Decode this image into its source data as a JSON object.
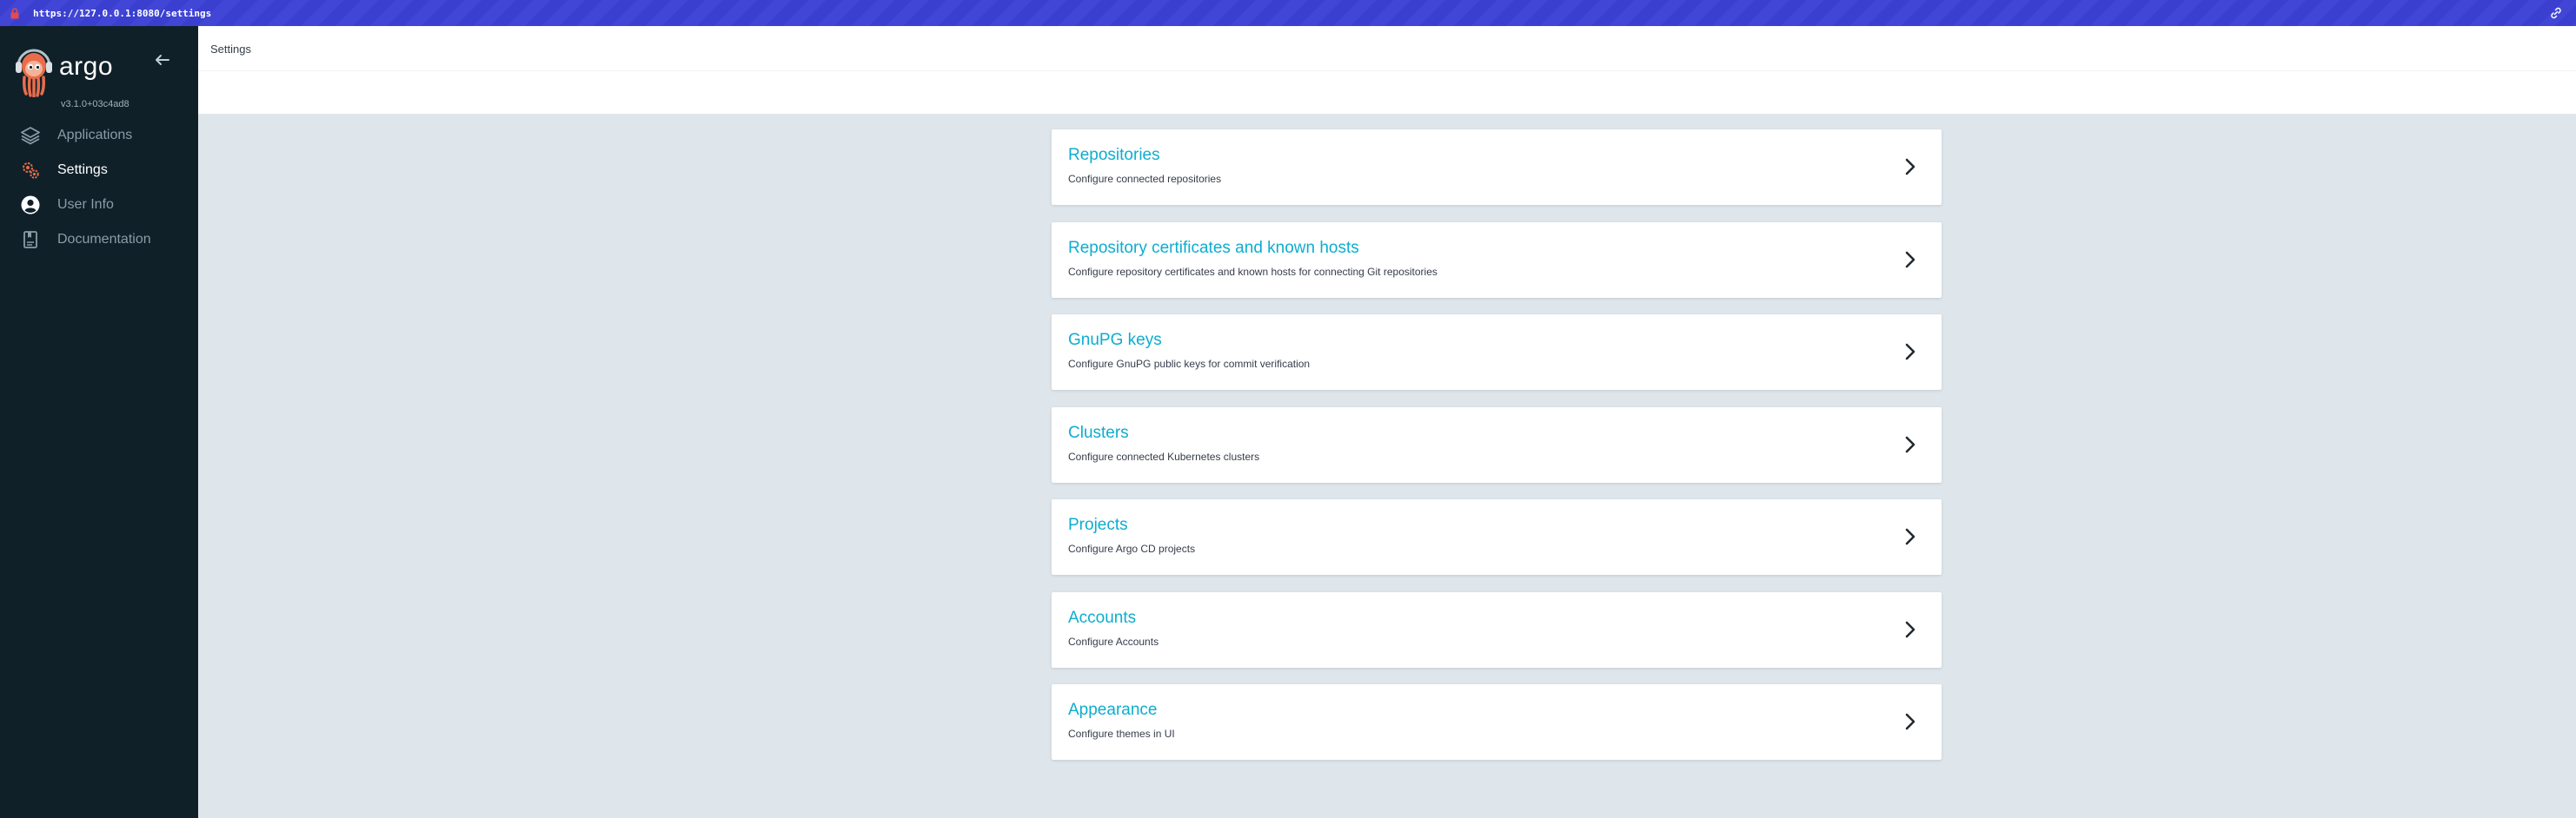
{
  "browser": {
    "url": "https://127.0.0.1:8080/settings"
  },
  "sidebar": {
    "brand_name": "argo",
    "version": "v3.1.0+03c4ad8",
    "items": [
      {
        "label": "Applications",
        "icon": "layers-icon",
        "active": false
      },
      {
        "label": "Settings",
        "icon": "gears-icon",
        "active": true
      },
      {
        "label": "User Info",
        "icon": "user-circle-icon",
        "active": false
      },
      {
        "label": "Documentation",
        "icon": "book-icon",
        "active": false
      }
    ]
  },
  "header": {
    "title": "Settings"
  },
  "settings_cards": [
    {
      "title": "Repositories",
      "description": "Configure connected repositories"
    },
    {
      "title": "Repository certificates and known hosts",
      "description": "Configure repository certificates and known hosts for connecting Git repositories"
    },
    {
      "title": "GnuPG keys",
      "description": "Configure GnuPG public keys for commit verification"
    },
    {
      "title": "Clusters",
      "description": "Configure connected Kubernetes clusters"
    },
    {
      "title": "Projects",
      "description": "Configure Argo CD projects"
    },
    {
      "title": "Accounts",
      "description": "Configure Accounts"
    },
    {
      "title": "Appearance",
      "description": "Configure themes in UI"
    }
  ],
  "colors": {
    "accent": "#0dadcf",
    "sidebar_bg": "#0f2029",
    "page_bg": "#dee6eb",
    "url_bar": "#3a3fd0",
    "logo_orange": "#e96d4b"
  }
}
